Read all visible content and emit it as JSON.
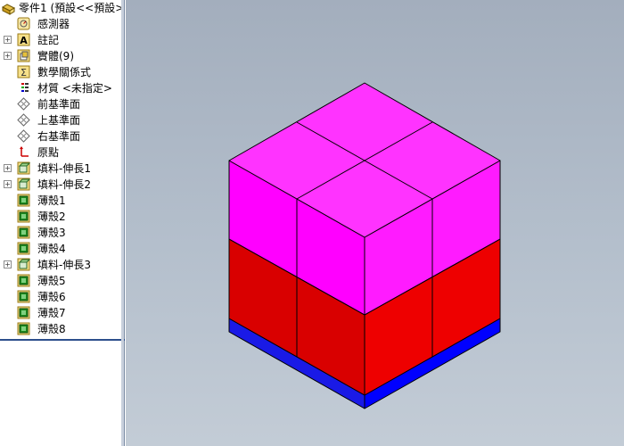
{
  "tree": {
    "root_label": "零件1 (預設<<預設>_",
    "items": [
      {
        "label": "感測器",
        "icon": "sensor-icon",
        "expander": false
      },
      {
        "label": "註記",
        "icon": "annotation-icon",
        "expander": true
      },
      {
        "label": "實體(9)",
        "icon": "solid-bodies-icon",
        "expander": true
      },
      {
        "label": "數學關係式",
        "icon": "equation-icon",
        "expander": false
      },
      {
        "label": "材質 <未指定>",
        "icon": "material-icon",
        "expander": false
      },
      {
        "label": "前基準面",
        "icon": "plane-icon",
        "expander": false
      },
      {
        "label": "上基準面",
        "icon": "plane-icon",
        "expander": false
      },
      {
        "label": "右基準面",
        "icon": "plane-icon",
        "expander": false
      },
      {
        "label": "原點",
        "icon": "origin-icon",
        "expander": false
      },
      {
        "label": "填料-伸長1",
        "icon": "extrude-icon",
        "expander": true
      },
      {
        "label": "填料-伸長2",
        "icon": "extrude-icon",
        "expander": true
      },
      {
        "label": "薄殼1",
        "icon": "shell-icon",
        "expander": false
      },
      {
        "label": "薄殼2",
        "icon": "shell-icon",
        "expander": false
      },
      {
        "label": "薄殼3",
        "icon": "shell-icon",
        "expander": false
      },
      {
        "label": "薄殼4",
        "icon": "shell-icon",
        "expander": false
      },
      {
        "label": "填料-伸長3",
        "icon": "extrude-icon",
        "expander": true
      },
      {
        "label": "薄殼5",
        "icon": "shell-icon",
        "expander": false
      },
      {
        "label": "薄殼6",
        "icon": "shell-icon",
        "expander": false
      },
      {
        "label": "薄殼7",
        "icon": "shell-icon",
        "expander": false
      },
      {
        "label": "薄殼8",
        "icon": "shell-icon",
        "expander": false
      }
    ]
  },
  "colors": {
    "magenta_top": "#ff33ff",
    "magenta_left": "#ff00ff",
    "magenta_right": "#ff1bff",
    "red_left": "#d90000",
    "red_right": "#ee0000",
    "blue_left": "#1a1ae6",
    "blue_right": "#0000ff"
  }
}
